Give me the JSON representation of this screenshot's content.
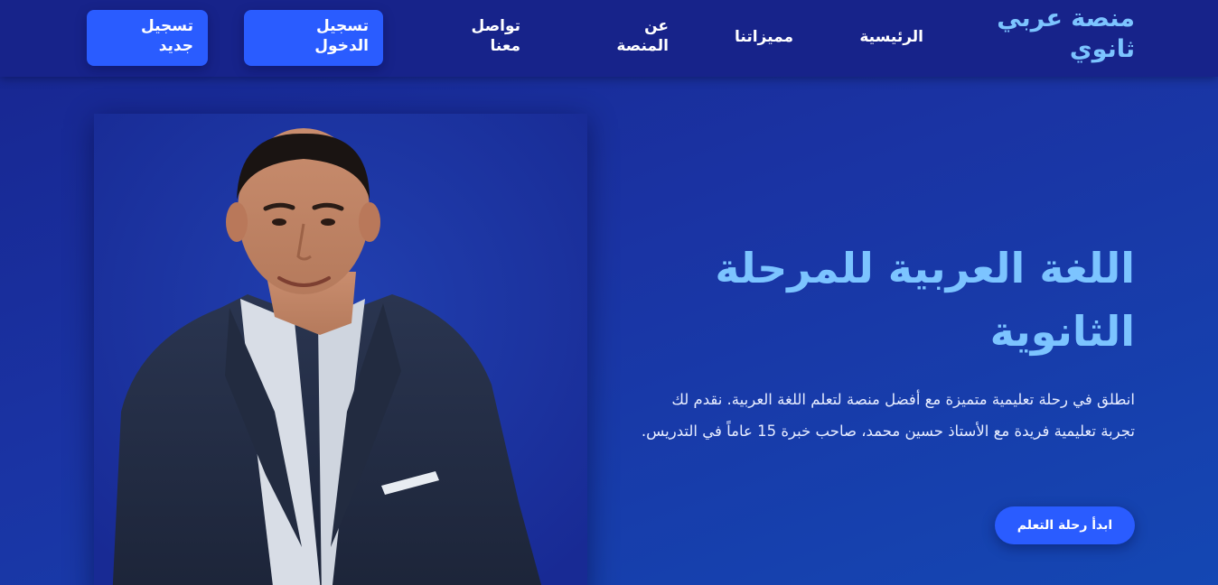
{
  "nav": {
    "brand": "منصة عربي ثانوي",
    "links": {
      "home": "الرئيسية",
      "features": "مميزاتنا",
      "about": "عن المنصة",
      "contact": "تواصل معنا"
    },
    "login_label": "تسجيل الدخول",
    "register_label": "تسجيل جديد"
  },
  "hero": {
    "title": "اللغة العربية للمرحلة الثانوية",
    "description": "انطلق في رحلة تعليمية متميزة مع أفضل منصة لتعلم اللغة العربية. نقدم لك تجربة تعليمية فريدة مع الأستاذ حسين محمد، صاحب خبرة 15 عاماً في التدريس.",
    "cta_label": "ابدأ رحلة التعلم"
  },
  "colors": {
    "accent": "#2a5cff",
    "brand_text": "#7cc4ff",
    "nav_bg": "#17238a"
  },
  "icons": {
    "teacher_photo": "teacher-portrait"
  }
}
